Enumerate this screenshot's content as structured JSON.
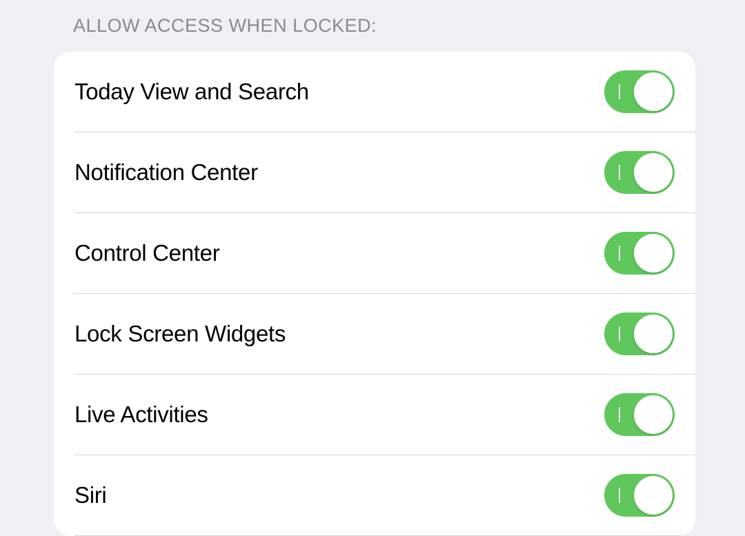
{
  "section": {
    "header": "ALLOW ACCESS WHEN LOCKED:",
    "items": [
      {
        "label": "Today View and Search",
        "on": true
      },
      {
        "label": "Notification Center",
        "on": true
      },
      {
        "label": "Control Center",
        "on": true
      },
      {
        "label": "Lock Screen Widgets",
        "on": true
      },
      {
        "label": "Live Activities",
        "on": true
      },
      {
        "label": "Siri",
        "on": true
      }
    ]
  },
  "colors": {
    "toggle_on": "#5fc75c",
    "background": "#f0eff4",
    "group_background": "#ffffff",
    "divider": "#d6d6d9",
    "header_text": "#8a8a8e",
    "label_text": "#000000"
  }
}
